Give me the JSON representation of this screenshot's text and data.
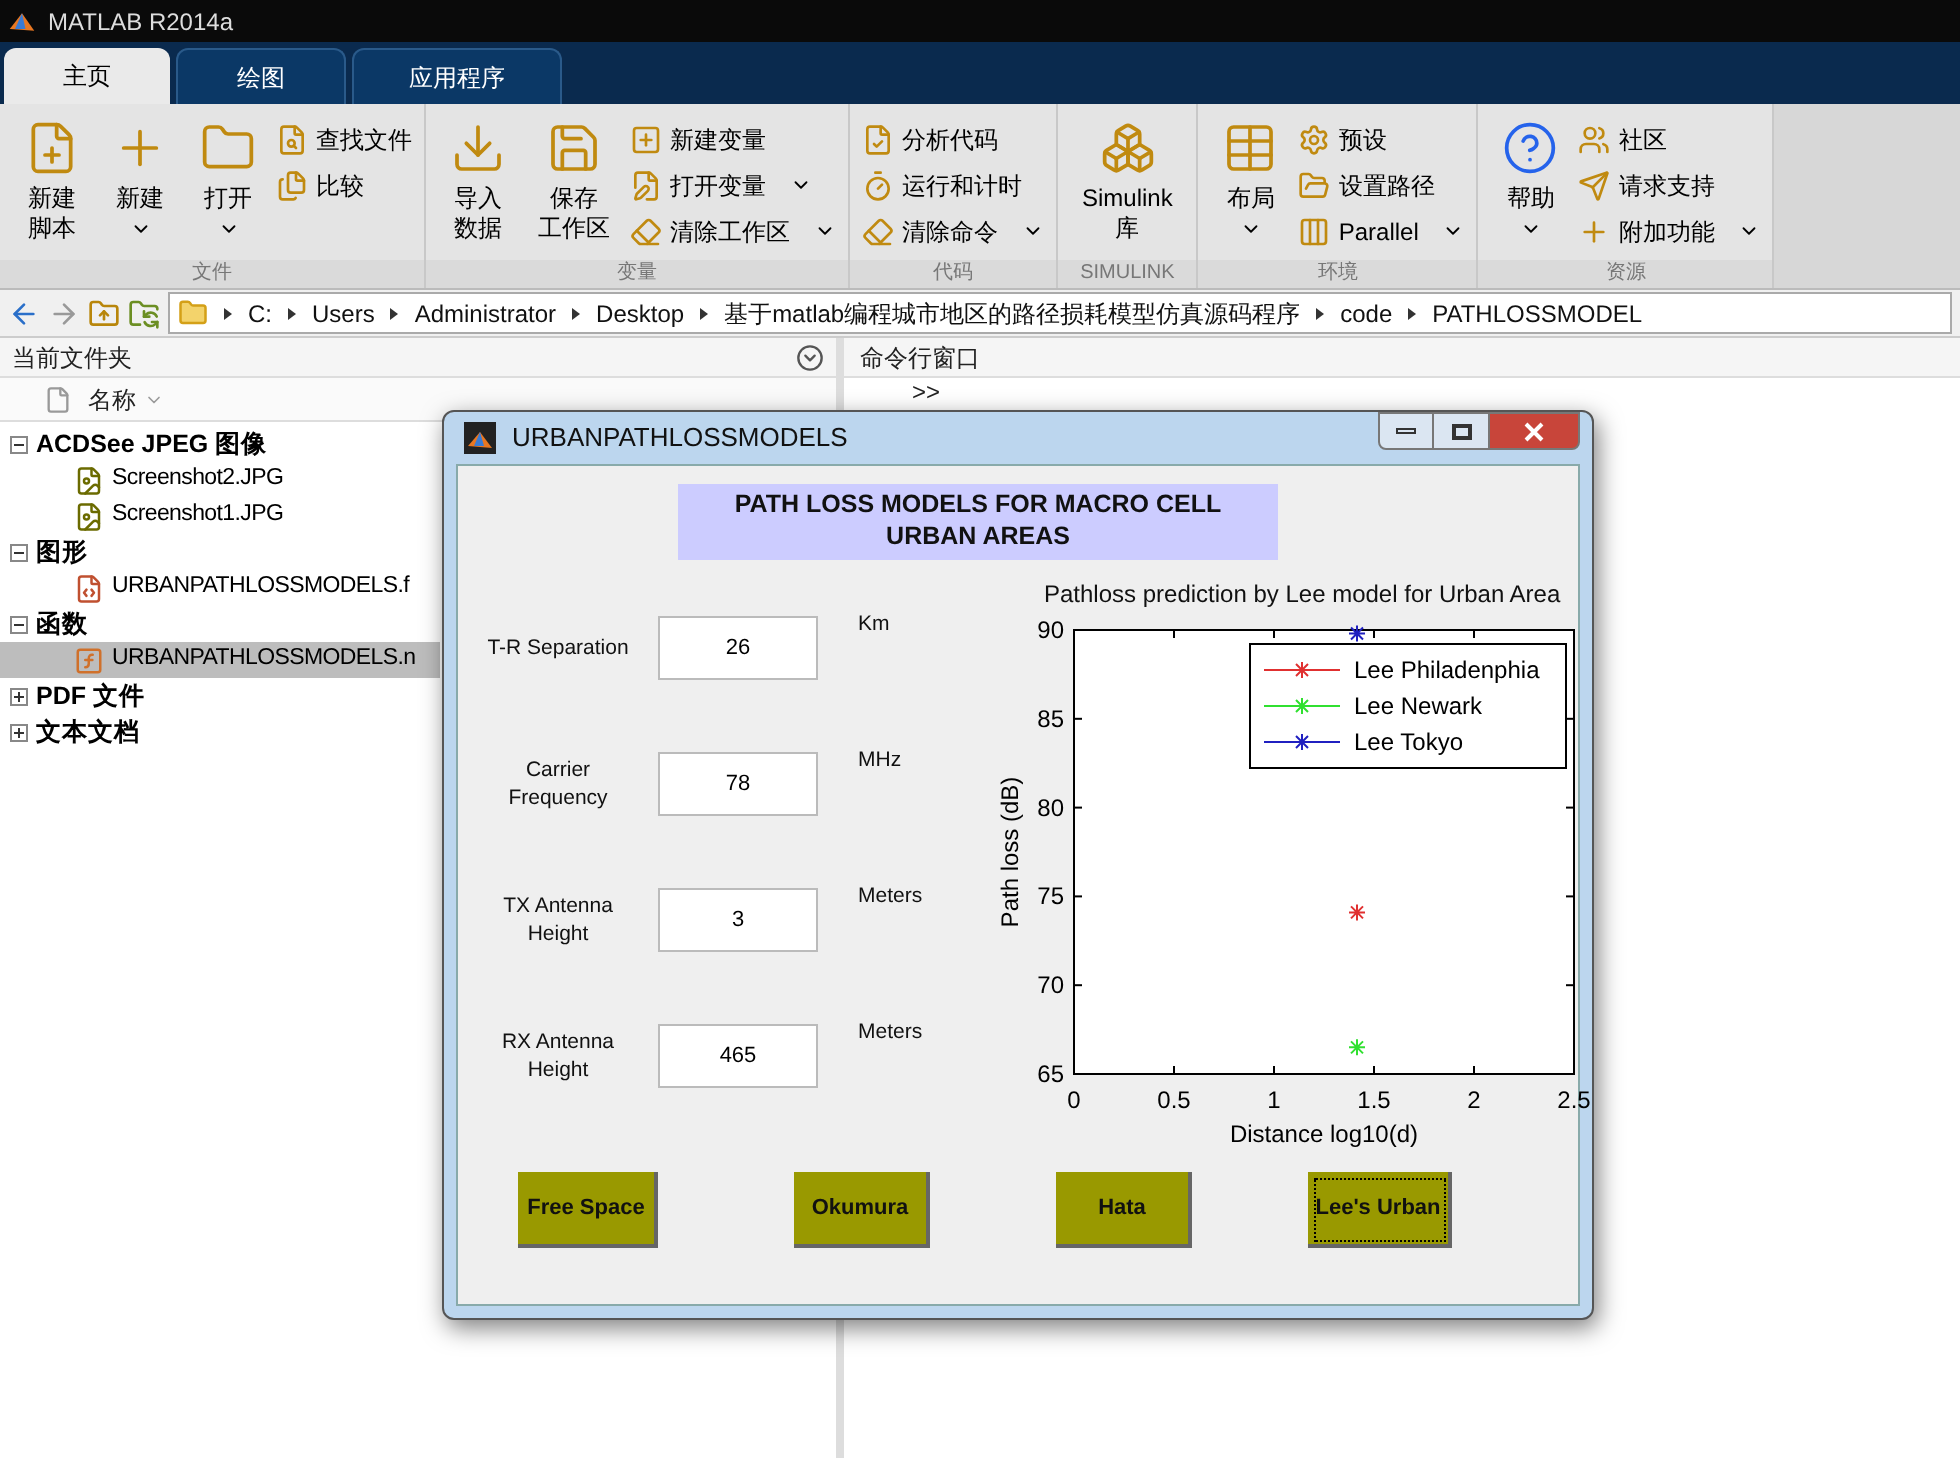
{
  "app_title": "MATLAB R2014a",
  "tabs": [
    {
      "label": "主页",
      "selected": true
    },
    {
      "label": "绘图",
      "selected": false
    },
    {
      "label": "应用程序",
      "selected": false
    }
  ],
  "ribbon": [
    {
      "group": "文件",
      "items": [
        {
          "label_lines": [
            "新建",
            "脚本"
          ],
          "kind": "large",
          "dropdown": false
        },
        {
          "label_lines": [
            "新建"
          ],
          "kind": "large",
          "dropdown": true
        },
        {
          "label_lines": [
            "打开"
          ],
          "kind": "large",
          "dropdown": true
        },
        {
          "label": "查找文件",
          "kind": "small",
          "dropdown": false
        },
        {
          "label": "比较",
          "kind": "small",
          "dropdown": false
        }
      ]
    },
    {
      "group": "变量",
      "items": [
        {
          "label_lines": [
            "导入",
            "数据"
          ],
          "kind": "large",
          "dropdown": false
        },
        {
          "label_lines": [
            "保存",
            "工作区"
          ],
          "kind": "large",
          "dropdown": false
        },
        {
          "label": "新建变量",
          "kind": "small",
          "dropdown": false
        },
        {
          "label": "打开变量",
          "kind": "small",
          "dropdown": true
        },
        {
          "label": "清除工作区",
          "kind": "small",
          "dropdown": true
        }
      ]
    },
    {
      "group": "代码",
      "items": [
        {
          "label": "分析代码",
          "kind": "small",
          "dropdown": false
        },
        {
          "label": "运行和计时",
          "kind": "small",
          "dropdown": false
        },
        {
          "label": "清除命令",
          "kind": "small",
          "dropdown": true
        }
      ]
    },
    {
      "group": "SIMULINK",
      "items": [
        {
          "label_lines": [
            "Simulink",
            "库"
          ],
          "kind": "large",
          "dropdown": false
        }
      ]
    },
    {
      "group": "环境",
      "items": [
        {
          "label_lines": [
            "布局"
          ],
          "kind": "large",
          "dropdown": true
        },
        {
          "label": "预设",
          "kind": "small",
          "dropdown": false
        },
        {
          "label": "设置路径",
          "kind": "small",
          "dropdown": false
        },
        {
          "label": "Parallel",
          "kind": "small",
          "dropdown": true
        }
      ]
    },
    {
      "group": "资源",
      "items": [
        {
          "label_lines": [
            "帮助"
          ],
          "kind": "large",
          "dropdown": true
        },
        {
          "label": "社区",
          "kind": "small",
          "dropdown": false
        },
        {
          "label": "请求支持",
          "kind": "small",
          "dropdown": false
        },
        {
          "label": "附加功能",
          "kind": "small",
          "dropdown": true
        }
      ]
    }
  ],
  "path": [
    "C:",
    "Users",
    "Administrator",
    "Desktop",
    "基于matlab编程城市地区的路径损耗模型仿真源码程序",
    "code",
    "PATHLOSSMODEL"
  ],
  "file_panel": {
    "title": "当前文件夹",
    "column": "名称",
    "groups": [
      {
        "label": "ACDSee JPEG 图像",
        "expanded": true,
        "children": [
          {
            "name": "Screenshot2.JPG",
            "kind": "jpg",
            "selected": false
          },
          {
            "name": "Screenshot1.JPG",
            "kind": "jpg",
            "selected": false
          }
        ]
      },
      {
        "label": "图形",
        "expanded": true,
        "children": [
          {
            "name": "URBANPATHLOSSMODELS.f",
            "kind": "fig",
            "selected": false
          }
        ]
      },
      {
        "label": "函数",
        "expanded": true,
        "children": [
          {
            "name": "URBANPATHLOSSMODELS.n",
            "kind": "func",
            "selected": true
          }
        ]
      },
      {
        "label": "PDF 文件",
        "expanded": false
      },
      {
        "label": "文本文档",
        "expanded": false
      }
    ]
  },
  "command_window": {
    "title": "命令行窗口",
    "prompt": ">>"
  },
  "figure": {
    "title": "URBANPATHLOSSMODELS",
    "heading": "PATH LOSS MODELS FOR MACRO CELL\nURBAN AREAS",
    "fields": [
      {
        "label": "T-R Separation",
        "value": "26",
        "unit": "Km"
      },
      {
        "label": "Carrier\nFrequency",
        "value": "78",
        "unit": "MHz"
      },
      {
        "label": "TX Antenna\nHeight",
        "value": "3",
        "unit": "Meters"
      },
      {
        "label": "RX Antenna\nHeight",
        "value": "465",
        "unit": "Meters"
      }
    ],
    "chart_data": {
      "type": "scatter",
      "title": "Pathloss prediction by Lee model for Urban Area",
      "xlabel": "Distance log10(d)",
      "ylabel": "Path loss (dB)",
      "xlim": [
        0,
        2.5
      ],
      "ylim": [
        65,
        90
      ],
      "xticks": [
        0,
        0.5,
        1,
        1.5,
        2,
        2.5
      ],
      "yticks": [
        65,
        70,
        75,
        80,
        85,
        90
      ],
      "legend": "top right",
      "x": [
        1.415
      ],
      "series": [
        {
          "name": "Lee Philadenphia",
          "color": "#e03030",
          "values": [
            74.1
          ]
        },
        {
          "name": "Lee Newark",
          "color": "#30e030",
          "values": [
            66.5
          ]
        },
        {
          "name": "Lee Tokyo",
          "color": "#2020c0",
          "values": [
            89.8
          ]
        }
      ]
    },
    "buttons": [
      {
        "label": "Free Space",
        "selected": false
      },
      {
        "label": "Okumura",
        "selected": false
      },
      {
        "label": "Hata",
        "selected": false
      },
      {
        "label": "Lee's Urban",
        "selected": true
      }
    ]
  }
}
